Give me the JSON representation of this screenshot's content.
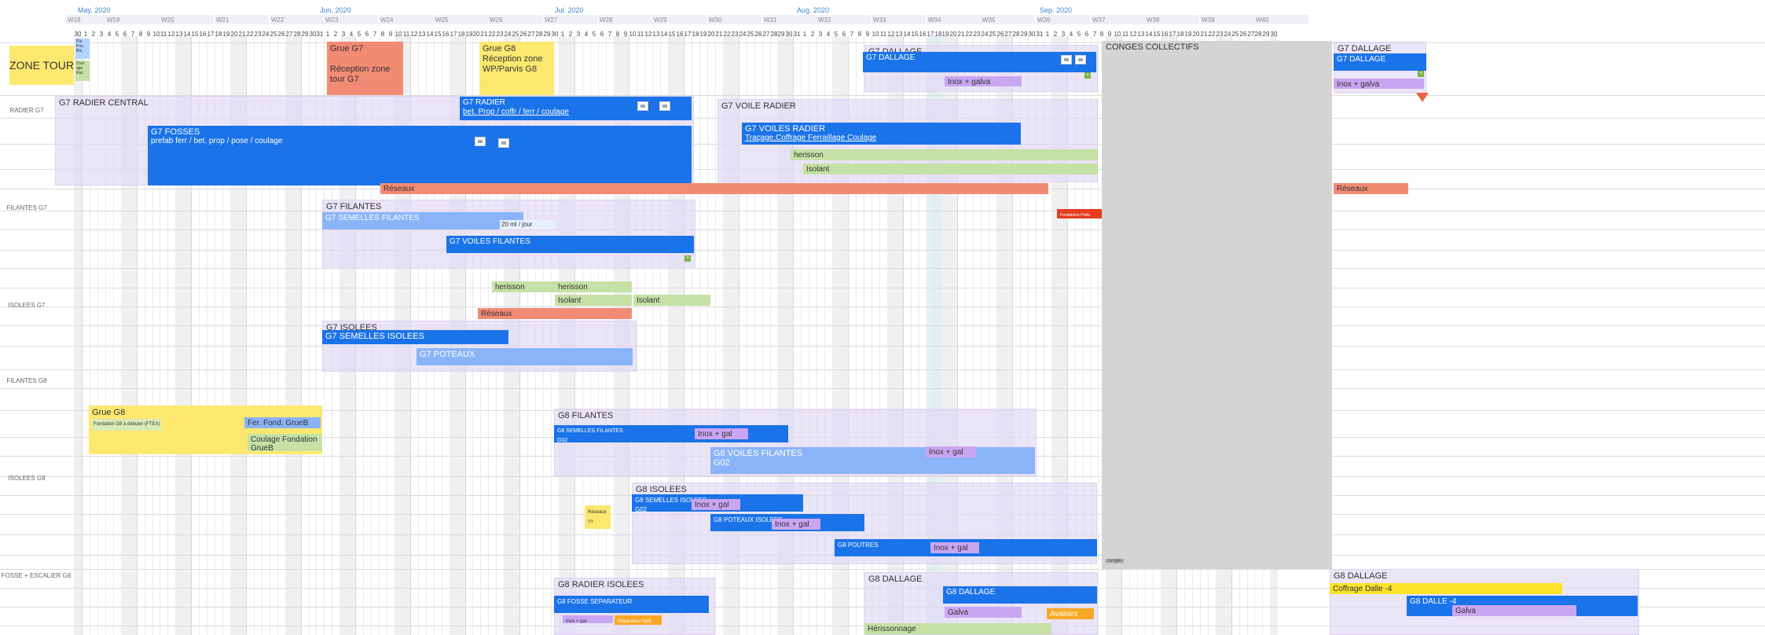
{
  "months": [
    {
      "label": "May. 2020",
      "col": 1
    },
    {
      "label": "Jun. 2020",
      "col": 32
    },
    {
      "label": "Jul. 2020",
      "col": 62
    },
    {
      "label": "Aug. 2020",
      "col": 93
    },
    {
      "label": "Sep. 2020",
      "col": 124
    }
  ],
  "weeks": [
    "W18",
    "W19",
    "W20",
    "W21",
    "W22",
    "W23",
    "W24",
    "W25",
    "W26",
    "W27",
    "W28",
    "W29",
    "W30",
    "W31",
    "W32",
    "W33",
    "W34",
    "W35",
    "W36",
    "W37",
    "W38",
    "W39",
    "W40"
  ],
  "days": [
    30,
    1,
    2,
    3,
    4,
    5,
    6,
    7,
    8,
    9,
    10,
    11,
    12,
    13,
    14,
    15,
    16,
    17,
    18,
    19,
    20,
    21,
    22,
    23,
    24,
    25,
    26,
    27,
    28,
    29,
    30,
    31,
    1,
    2,
    3,
    4,
    5,
    6,
    7,
    8,
    9,
    10,
    11,
    12,
    13,
    14,
    15,
    16,
    17,
    18,
    19,
    20,
    21,
    22,
    23,
    24,
    25,
    26,
    27,
    28,
    29,
    30,
    1,
    2,
    3,
    4,
    5,
    6,
    7,
    8,
    9,
    10,
    11,
    12,
    13,
    14,
    15,
    16,
    17,
    18,
    19,
    20,
    21,
    22,
    23,
    24,
    25,
    26,
    27,
    28,
    29,
    30,
    31,
    1,
    2,
    3,
    4,
    5,
    6,
    7,
    8,
    9,
    10,
    11,
    12,
    13,
    14,
    15,
    16,
    17,
    18,
    19,
    20,
    21,
    22,
    23,
    24,
    25,
    26,
    27,
    28,
    29,
    30,
    31,
    1,
    2,
    3,
    4,
    5,
    6,
    7,
    8,
    9,
    10,
    11,
    12,
    13,
    14,
    15,
    16,
    17,
    18,
    19,
    20,
    21,
    22,
    23,
    24,
    25,
    26,
    27,
    28,
    29,
    30
  ],
  "row_labels": [
    "RADIER G7",
    "FILANTES G7",
    "ISOLEES G7",
    "FILANTES G8",
    "ISOLEES G8",
    "FOSSE + ESCALIER G8"
  ],
  "notes": {
    "zone_tour": "ZONE TOUR",
    "sticky_a": "Pla Pou Bla",
    "sticky_b": "Coul age Rac",
    "grue_g7": "Grue G7",
    "grue_g7_desc": "Réception zone tour G7",
    "grue_g8_top": "Grue G8",
    "grue_g8_top_desc": "Réception zone WP/Parvis G8",
    "grue_g8": "Grue G8",
    "grue_g8_sub": "Fondation G8 à débuter (FTEX)",
    "fer_fond": "Fer. Fond. GrueB",
    "coulage_fond": "Coulage Fondation GrueB",
    "reseaux_q": "Réseaux ??",
    "conges": "CONGES COLLECTIFS",
    "conges_tag": "congés"
  },
  "groups": {
    "g7_dallage_top": "G7 DALLAGE",
    "g7_dallage_right": "G7 DALLAGE",
    "g7_radier_central": "G7 RADIER CENTRAL",
    "g7_voile_radier": "G7 VOILE RADIER",
    "g7_filantes": "G7 FILANTES",
    "g7_isolees": "G7 ISOLEES",
    "g8_filantes": "G8 FILANTES",
    "g8_isolees": "G8 ISOLEES",
    "g8_radier_isolees": "G8 RADIER ISOLEES",
    "g8_dallage_mid": "G8 DALLAGE",
    "g8_dallage_right": "G8 DALLAGE"
  },
  "tasks": {
    "g7_dallage_bar": "G7 DALLAGE",
    "g7_dallage_bar_r": "G7 DALLAGE",
    "inox_galva": "Inox + galva",
    "inox_galva_r": "Inox + galva",
    "g7_radier": "G7 RADIER",
    "g7_radier_sub": "bet. Prop / coffr / ferr / coulage",
    "g7_fosses": "G7 FOSSES",
    "g7_fosses_sub": "prefab ferr / bet. prop / pose / coulage",
    "g7_voiles_radier": "G7 VOILES RADIER",
    "g7_voiles_radier_sub": "Traçage,Coffrage Ferraillage Coulage",
    "herisson": "herisson",
    "isolant": "Isolant",
    "reseaux": "Réseaux",
    "reseaux_r": "Réseaux",
    "fondations_prefa": "Fondations Préfa",
    "g7_semelles_filantes": "G7 SEMELLES FILANTES",
    "ml_jour": "20 ml / jour",
    "g7_voiles_filantes": "G7 VOILES FILANTES",
    "herisson_a": "herisson",
    "herisson_b": "herisson",
    "isolant_a": "Isolant",
    "isolant_b": "Isolant",
    "reseaux_mid": "Réseaux",
    "g7_semelles_isolees": "G7 SEMELLES  ISOLEES",
    "g7_poteaux": "G7 POTEAUX",
    "g8_semelles_filantes": "G8 SEMELLES FILANTES",
    "g8_semelles_filantes_sub": "G02",
    "inox_gal_1": "Inox + gal",
    "g8_voiles_filantes": "G8 VOILES FILANTES",
    "g8_voiles_filantes_sub": "G02",
    "inox_gal_2": "Inox + gal",
    "g8_semelles_isolees": "G8 SEMELLES ISOLEES",
    "g8_semelles_isolees_sub": "G02",
    "inox_gal_3": "Inox + gal",
    "g8_poteaux_isolees": "G8 POTEAUX ISOLEES",
    "inox_gal_4": "Inox + gal",
    "g8_poutres": "G8 POUTRES",
    "inox_gal_5": "Inox + gal",
    "g8_fosse_separateur": "G8 FOSSE SEPARATEUR",
    "inox_gal_6": "Inox + gal",
    "separateur": "Séparateur hydr.",
    "g8_dallage_bar": "G8 DALLAGE",
    "galva": "Galva",
    "avaloirs": "Avaloirs",
    "herissonnage": "Hérissonnage",
    "coffrage_dalle": "Coffrage Dalle -4",
    "g8_dalle": "G8 DALLE -4",
    "galva_r": "Galva"
  }
}
